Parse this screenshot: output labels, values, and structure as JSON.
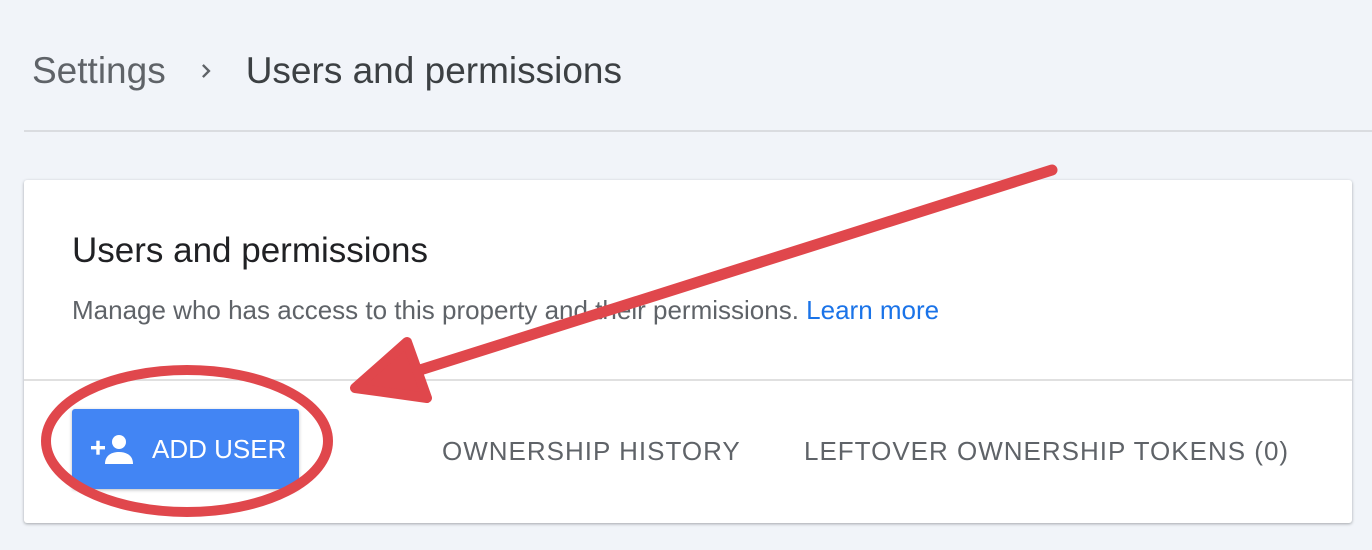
{
  "breadcrumb": {
    "parent": "Settings",
    "current": "Users and permissions"
  },
  "card": {
    "title": "Users and permissions",
    "description": "Manage who has access to this property and their permissions.",
    "learn_more": "Learn more"
  },
  "actions": {
    "add_user_label": "ADD USER",
    "add_user_icon": "person-add-icon",
    "ownership_history_label": "OWNERSHIP HISTORY",
    "leftover_tokens_label": "LEFTOVER OWNERSHIP TOKENS (0)"
  },
  "colors": {
    "page_background": "#f1f4f9",
    "primary_button": "#4285f4",
    "link": "#1a73e8",
    "annotation": "#e0474c"
  },
  "annotation": {
    "shapes": [
      "red-arrow",
      "red-ellipse"
    ]
  }
}
